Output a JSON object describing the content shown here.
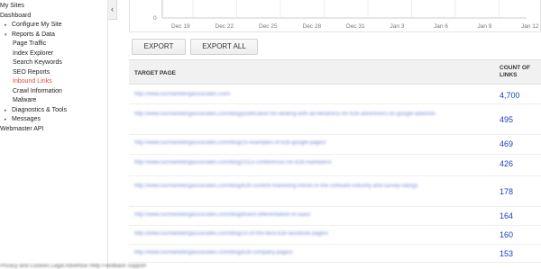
{
  "sidebar": {
    "items": [
      {
        "label": "My Sites",
        "level": 0,
        "arrow": "",
        "active": false
      },
      {
        "label": "Dashboard",
        "level": 0,
        "arrow": "",
        "active": false
      },
      {
        "label": "Configure My Site",
        "level": 1,
        "arrow": "▸",
        "active": false
      },
      {
        "label": "Reports & Data",
        "level": 1,
        "arrow": "▾",
        "active": false
      },
      {
        "label": "Page Traffic",
        "level": 2,
        "arrow": "",
        "active": false
      },
      {
        "label": "Index Explorer",
        "level": 2,
        "arrow": "",
        "active": false
      },
      {
        "label": "Search Keywords",
        "level": 2,
        "arrow": "",
        "active": false
      },
      {
        "label": "SEO Reports",
        "level": 2,
        "arrow": "",
        "active": false
      },
      {
        "label": "Inbound Links",
        "level": 2,
        "arrow": "",
        "active": true
      },
      {
        "label": "Crawl Information",
        "level": 2,
        "arrow": "",
        "active": false
      },
      {
        "label": "Malware",
        "level": 2,
        "arrow": "",
        "active": false
      },
      {
        "label": "Diagnostics & Tools",
        "level": 1,
        "arrow": "▸",
        "active": false
      },
      {
        "label": "Messages",
        "level": 1,
        "arrow": "▸",
        "active": false
      },
      {
        "label": "Webmaster API",
        "level": 0,
        "arrow": "",
        "active": false
      }
    ],
    "collapse_glyph": "‹"
  },
  "chart": {
    "y_tick": "0",
    "x_ticks": [
      "Dec 19",
      "Dec 22",
      "Dec 25",
      "Dec 28",
      "Dec 31",
      "Jan 3",
      "Jan 6",
      "Jan 9",
      "Jan 12"
    ]
  },
  "toolbar": {
    "export_label": "EXPORT",
    "export_all_label": "EXPORT ALL"
  },
  "table": {
    "col_page": "TARGET PAGE",
    "col_count_line1": "COUNT OF",
    "col_count_line2": "LINKS",
    "rows": [
      {
        "url": "http://www.lucmarketingassociates.com/",
        "count": "4,700"
      },
      {
        "url": "http://www.lucmarketingassociates.com/blog/justification-for-dealing-with-ad-blindness-for-b2b-advertisers-on-google-adwords",
        "count": "495"
      },
      {
        "url": "http://www.lucmarketingassociates.com/blog/15-examples-of-b2b-google-pages/",
        "count": "469"
      },
      {
        "url": "http://www.lucmarketingassociates.com/blog/2013-conferences-for-b2b-marketers/",
        "count": "426"
      },
      {
        "url": "http://www.lucmarketingassociates.com/blog/b2b-content-marketing-trends-in-the-software-industry-and-survey-ratings",
        "count": "178"
      },
      {
        "url": "http://www.lucmarketingassociates.com/blog/brand-differentiation-in-saas/",
        "count": "164"
      },
      {
        "url": "http://www.lucmarketingassociates.com/blog/10-of-the-best-b2b-facebook-pages/",
        "count": "160"
      },
      {
        "url": "http://www.lucmarketingassociates.com/blog/b2b-company-pages/",
        "count": "153"
      }
    ]
  },
  "footer": {
    "text": "Privacy and Cookies   Legal   Advertise   Help   Feedback   Support"
  }
}
